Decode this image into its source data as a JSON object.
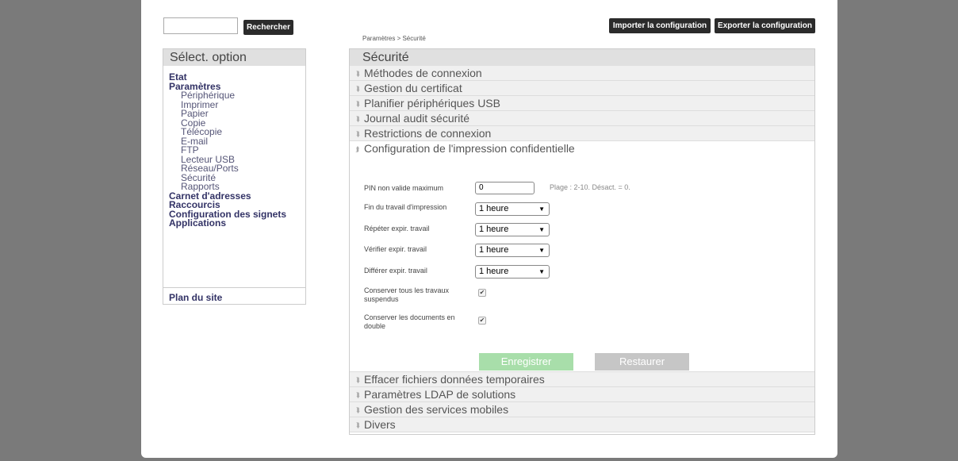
{
  "search": {
    "button_label": "Rechercher",
    "value": ""
  },
  "header": {
    "import_label": "Importer la configuration",
    "export_label": "Exporter la configuration",
    "breadcrumb": "Paramètres > Sécurité"
  },
  "sidebar": {
    "title": "Sélect. option",
    "items": [
      {
        "label": "Etat",
        "level": 1
      },
      {
        "label": "Paramètres",
        "level": 1
      },
      {
        "label": "Périphérique",
        "level": 2
      },
      {
        "label": "Imprimer",
        "level": 2
      },
      {
        "label": "Papier",
        "level": 2
      },
      {
        "label": "Copie",
        "level": 2
      },
      {
        "label": "Télécopie",
        "level": 2
      },
      {
        "label": "E-mail",
        "level": 2
      },
      {
        "label": "FTP",
        "level": 2
      },
      {
        "label": "Lecteur USB",
        "level": 2
      },
      {
        "label": "Réseau/Ports",
        "level": 2
      },
      {
        "label": "Sécurité",
        "level": 2
      },
      {
        "label": "Rapports",
        "level": 2
      },
      {
        "label": "Carnet d'adresses",
        "level": 1
      },
      {
        "label": "Raccourcis",
        "level": 1
      },
      {
        "label": "Configuration des signets",
        "level": 1
      },
      {
        "label": "Applications",
        "level": 1
      }
    ],
    "sitemap": "Plan du site"
  },
  "main": {
    "title": "Sécurité",
    "sections_before": [
      "Méthodes de connexion",
      "Gestion du certificat",
      "Planifier périphériques USB",
      "Journal audit sécurité",
      "Restrictions de connexion"
    ],
    "open_section": "Configuration de l'impression confidentielle",
    "form": {
      "pin_label": "PIN non valide maximum",
      "pin_value": "0",
      "pin_range": "Plage : 2-10. Désact. = 0.",
      "end_job_label": "Fin du travail d'impression",
      "end_job_value": "1 heure",
      "repeat_label": "Répéter expir. travail",
      "repeat_value": "1 heure",
      "verify_label": "Vérifier expir. travail",
      "verify_value": "1 heure",
      "defer_label": "Différer expir. travail",
      "defer_value": "1 heure",
      "keep_all_label": "Conserver tous les travaux suspendus",
      "keep_all_checked": true,
      "keep_dup_label": "Conserver les documents en double",
      "keep_dup_checked": true,
      "save_label": "Enregistrer",
      "restore_label": "Restaurer"
    },
    "sections_after": [
      "Effacer fichiers données temporaires",
      "Paramètres LDAP de solutions",
      "Gestion des services mobiles",
      "Divers"
    ]
  },
  "icons": {
    "collapsed": "chevron-double-down-icon",
    "expanded": "chevron-double-up-icon",
    "dropdown": "triangle-down-icon",
    "checkbox": "checkmark-icon"
  },
  "colors": {
    "save_button": "#a8deaa",
    "restore_button": "#c6c6c6",
    "dark_button": "#2b2b2b",
    "nav_text": "#333366"
  }
}
